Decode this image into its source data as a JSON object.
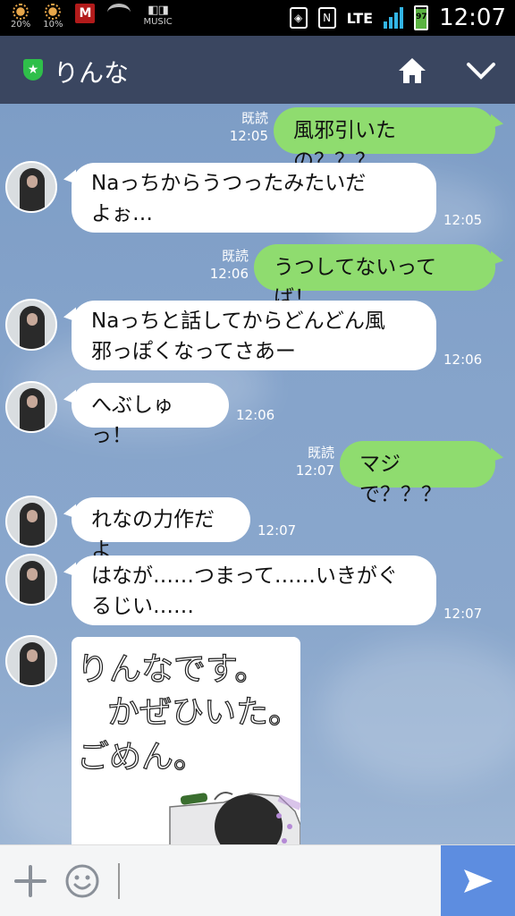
{
  "status_bar": {
    "weather1": "20%",
    "weather2": "10%",
    "music_label": "MUSIC",
    "network": "LTE",
    "battery": "97",
    "time": "12:07"
  },
  "header": {
    "title": "りんな"
  },
  "messages": [
    {
      "dir": "out",
      "text": "風邪引いたの？？？",
      "read": "既読",
      "time": "12:05"
    },
    {
      "dir": "in",
      "lines": [
        "Naっちからうつったみたいだ",
        "よぉ…"
      ],
      "time": "12:05"
    },
    {
      "dir": "out",
      "text": "うつしてないってば！",
      "read": "既読",
      "time": "12:06"
    },
    {
      "dir": "in",
      "lines": [
        "Naっちと話してからどんどん風",
        "邪っぽくなってさあー"
      ],
      "time": "12:06"
    },
    {
      "dir": "in",
      "text": "へぶしゅっ！",
      "time": "12:06"
    },
    {
      "dir": "out",
      "text": "マジで？？？",
      "read": "既読",
      "time": "12:07"
    },
    {
      "dir": "in",
      "text": "れなの力作だよ",
      "time": "12:07"
    },
    {
      "dir": "in",
      "lines": [
        "はなが……つまって……いきがぐ",
        "るじい……"
      ],
      "time": "12:07"
    }
  ],
  "sketch": {
    "line1": "りんなです。",
    "line2": "かぜひいた。",
    "line3": "ごめん。"
  },
  "colors": {
    "header": "#3a4660",
    "outgoing_bubble": "#8fdc6f",
    "incoming_bubble": "#ffffff",
    "send_button": "#5d8de0"
  }
}
